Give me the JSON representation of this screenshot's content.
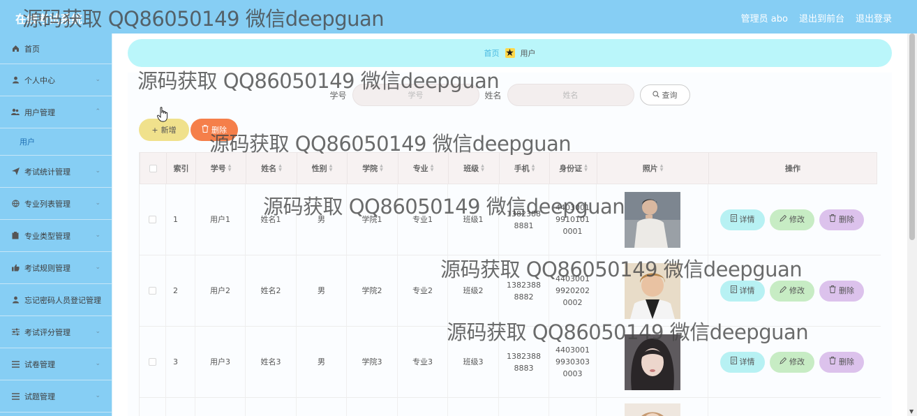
{
  "header": {
    "app_title": "在线考试系统",
    "admin_label": "管理员 abo",
    "back_front": "退出到前台",
    "logout": "退出登录"
  },
  "watermark": "源码获取 QQ86050149 微信deepguan",
  "sidebar": {
    "items": [
      {
        "label": "首页",
        "icon": "home-icon"
      },
      {
        "label": "个人中心",
        "icon": "user-icon"
      },
      {
        "label": "用户管理",
        "icon": "users-icon"
      },
      {
        "label": "用户",
        "icon": ""
      },
      {
        "label": "考试统计管理",
        "icon": "send-icon"
      },
      {
        "label": "专业列表管理",
        "icon": "globe-icon"
      },
      {
        "label": "专业类型管理",
        "icon": "clipboard-icon"
      },
      {
        "label": "考试规则管理",
        "icon": "thumb-icon"
      },
      {
        "label": "忘记密码人员登记管理",
        "icon": "person-icon"
      },
      {
        "label": "考试评分管理",
        "icon": "sliders-icon"
      },
      {
        "label": "试卷管理",
        "icon": "list-icon"
      },
      {
        "label": "试题管理",
        "icon": "list-icon"
      }
    ]
  },
  "breadcrumb": {
    "home": "首页",
    "current": "用户"
  },
  "search": {
    "field1_label": "学号",
    "field1_placeholder": "学号",
    "field2_label": "姓名",
    "field2_placeholder": "姓名",
    "query_label": "查询"
  },
  "actions": {
    "add_label": "新增",
    "delete_label": "删除"
  },
  "table": {
    "columns": [
      "索引",
      "学号",
      "姓名",
      "性别",
      "学院",
      "专业",
      "班级",
      "手机",
      "身份证",
      "照片",
      "操作"
    ],
    "rows": [
      {
        "index": "1",
        "id": "用户1",
        "name": "姓名1",
        "gender": "男",
        "college": "学院1",
        "major": "专业1",
        "class": "班级1",
        "phone": "13823888881",
        "idcard": "440300199101010001"
      },
      {
        "index": "2",
        "id": "用户2",
        "name": "姓名2",
        "gender": "男",
        "college": "学院2",
        "major": "专业2",
        "class": "班级2",
        "phone": "13823888882",
        "idcard": "440300199202020002"
      },
      {
        "index": "3",
        "id": "用户3",
        "name": "姓名3",
        "gender": "男",
        "college": "学院3",
        "major": "专业3",
        "class": "班级3",
        "phone": "13823888883",
        "idcard": "440300199303030003"
      }
    ],
    "detail_label": "详情",
    "edit_label": "修改",
    "remove_label": "删除"
  }
}
